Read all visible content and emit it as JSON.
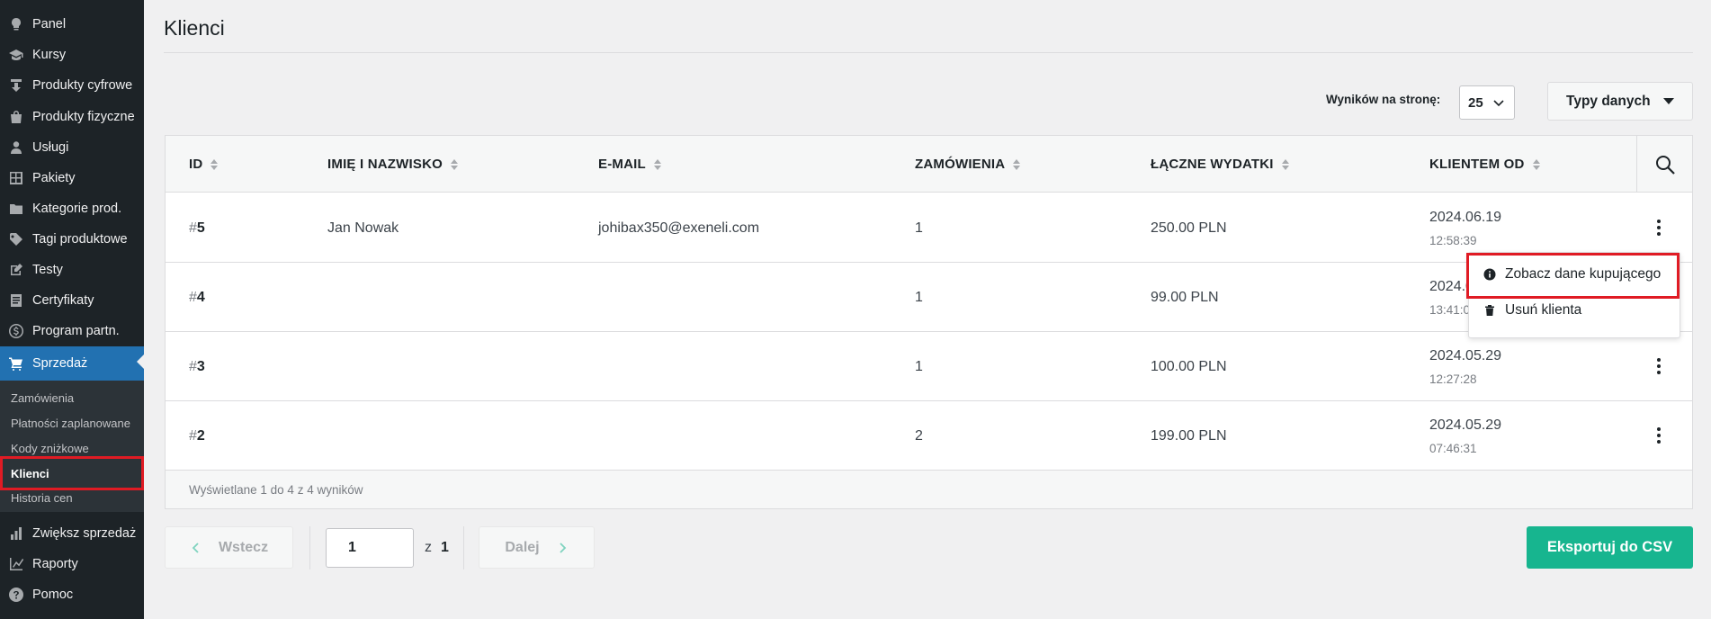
{
  "sidebar": {
    "items": [
      {
        "label": "Panel",
        "icon": "lightbulb-icon"
      },
      {
        "label": "Kursy",
        "icon": "graduation-cap-icon"
      },
      {
        "label": "Produkty cyfrowe",
        "icon": "download-icon"
      },
      {
        "label": "Produkty fizyczne",
        "icon": "bag-icon"
      },
      {
        "label": "Usługi",
        "icon": "user-icon"
      },
      {
        "label": "Pakiety",
        "icon": "grid-icon"
      },
      {
        "label": "Kategorie prod.",
        "icon": "folder-icon"
      },
      {
        "label": "Tagi produktowe",
        "icon": "tag-icon"
      },
      {
        "label": "Testy",
        "icon": "edit-icon"
      },
      {
        "label": "Certyfikaty",
        "icon": "document-icon"
      },
      {
        "label": "Program partn.",
        "icon": "dollar-icon"
      },
      {
        "label": "Sprzedaż",
        "icon": "cart-icon",
        "active": true
      },
      {
        "label": "Zwiększ sprzedaż",
        "icon": "bar-chart-icon"
      },
      {
        "label": "Raporty",
        "icon": "line-chart-icon"
      },
      {
        "label": "Pomoc",
        "icon": "help-icon"
      }
    ],
    "submenu": [
      {
        "label": "Zamówienia"
      },
      {
        "label": "Płatności zaplanowane"
      },
      {
        "label": "Kody zniżkowe"
      },
      {
        "label": "Klienci",
        "current": true
      },
      {
        "label": "Historia cen"
      }
    ]
  },
  "page": {
    "title": "Klienci"
  },
  "toolbar": {
    "per_page_label": "Wyników na stronę:",
    "per_page_value": "25",
    "types_label": "Typy danych"
  },
  "table": {
    "headers": [
      "ID",
      "Imię i nazwisko",
      "E-mail",
      "Zamówienia",
      "Łączne wydatki",
      "Klientem od"
    ],
    "rows": [
      {
        "hash": "#",
        "id": "5",
        "name": "Jan Nowak",
        "email": "johibax350@exeneli.com",
        "orders": "1",
        "spend": "250.00 PLN",
        "date": "2024.06.19",
        "time": "12:58:39"
      },
      {
        "hash": "#",
        "id": "4",
        "name": "",
        "email": "",
        "orders": "1",
        "spend": "99.00 PLN",
        "date": "2024.0",
        "time": "13:41:0"
      },
      {
        "hash": "#",
        "id": "3",
        "name": "",
        "email": "",
        "orders": "1",
        "spend": "100.00 PLN",
        "date": "2024.05.29",
        "time": "12:27:28"
      },
      {
        "hash": "#",
        "id": "2",
        "name": "",
        "email": "",
        "orders": "2",
        "spend": "199.00 PLN",
        "date": "2024.05.29",
        "time": "07:46:31"
      }
    ],
    "footer": "Wyświetlane 1 do 4 z 4 wyników"
  },
  "row_menu": {
    "view_buyer": "Zobacz dane kupującego",
    "delete_client": "Usuń klienta"
  },
  "pagination": {
    "prev": "Wstecz",
    "next": "Dalej",
    "current_page": "1",
    "of": "z",
    "total": "1"
  },
  "export_label": "Eksportuj do CSV",
  "colors": {
    "sidebar_bg": "#1d2327",
    "active_menu": "#2271b1",
    "export_btn": "#17b58f",
    "highlight": "#e01b24"
  }
}
